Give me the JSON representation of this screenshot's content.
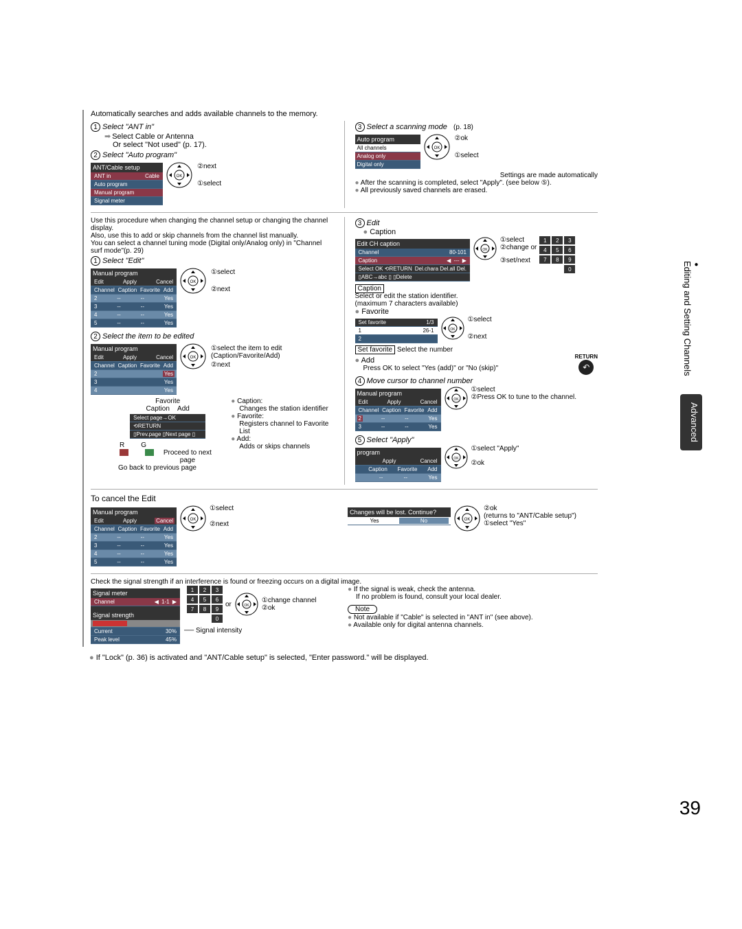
{
  "intro": "Automatically searches and adds available channels to the memory.",
  "sec1": {
    "step1": "Select \"ANT in\"",
    "sub1a": "Select Cable or Antenna",
    "sub1b": "Or select \"Not used\" (p. 17).",
    "step2": "Select \"Auto program\"",
    "menu1_title": "ANT/Cable setup",
    "menu1": {
      "r1a": "ANT in",
      "r1b": "Cable",
      "r2": "Auto program",
      "r3": "Manual program",
      "r4": "Signal meter"
    },
    "lbl_next": "next",
    "lbl_select": "select",
    "step3": "Select a scanning mode",
    "step3p": "(p. 18)",
    "menu2_title": "Auto program",
    "menu2": {
      "r1": "All channels",
      "r2": "Analog only",
      "r3": "Digital only"
    },
    "lbl_ok": "ok",
    "after1": "Settings are made automatically",
    "after2": "After the scanning is completed, select \"Apply\". (see below ⑤).",
    "after3": "All previously saved channels are erased."
  },
  "sec2": {
    "intro1": "Use this procedure when changing the channel setup or changing the channel display.",
    "intro2": "Also, use this to add or skip channels from the channel list manually.",
    "intro3": "You can select a channel tuning mode (Digital only/Analog only) in \"Channel surf mode\"(p. 29)",
    "step1": "Select \"Edit\"",
    "menu_manual": "Manual program",
    "mt": {
      "edit": "Edit",
      "apply": "Apply",
      "cancel": "Cancel",
      "channel": "Channel",
      "caption": "Caption",
      "favorite": "Favorite",
      "add": "Add",
      "yes": "Yes"
    },
    "lbl_select": "select",
    "lbl_next": "next",
    "step2": "Select the item to be edited",
    "lbl_selectitem": "select the item to edit (Caption/Favorite/Add)",
    "col_fav": "Favorite",
    "col_cap": "Caption",
    "col_add": "Add",
    "b_cap": "Caption:",
    "b_cap_t": "Changes the station identifier",
    "b_fav": "Favorite:",
    "b_fav_t": "Registers channel to Favorite List",
    "b_add": "Add:",
    "b_add_t": "Adds or skips channels",
    "rg_r": "R",
    "rg_g": "G",
    "rg_proc": "Proceed to next page",
    "rg_back": "Go back to previous page",
    "step3": "Edit",
    "step3cap": "Caption",
    "editch": "Edit CH caption",
    "ch": "Channel",
    "ch_v": "80-101",
    "cap": "Caption",
    "cap_v": "---",
    "lbl_change": "change  or",
    "lbl_setnext": "set/next",
    "caption_h": "Caption",
    "caption_t1": "Select or edit the station identifier.",
    "caption_t2": "(maximum 7 characters available)",
    "fav_h": "Favorite",
    "setfav": "Set favorite",
    "setfav_n": "1/3",
    "sf1": "1",
    "sf1v": "26-1",
    "sf2": "2",
    "setfav_sel": "Select the number",
    "add_h": "Add",
    "add_t": "Press OK to select \"Yes (add)\" or \"No (skip)\"",
    "return": "RETURN",
    "step4": "Move cursor to channel number",
    "lbl_press": "Press OK to tune to the channel.",
    "step5": "Select \"Apply\"",
    "prog": "program",
    "lbl_selapply": "select \"Apply\"",
    "lbl_ok": "ok"
  },
  "sec3": {
    "title": "To cancel the Edit",
    "lbl_select": "select",
    "lbl_next": "next",
    "confirm": "Changes will be lost. Continue?",
    "yes": "Yes",
    "no": "No",
    "lbl_ok": "ok",
    "lbl_ret": "(returns to \"ANT/Cable setup\")",
    "lbl_selyes": "select \"Yes\""
  },
  "sec4": {
    "intro": "Check the signal strength if an interference is found or freezing occurs on a digital image.",
    "signal_meter": "Signal meter",
    "channel": "Channel",
    "ch_v": "1-1",
    "strength": "Signal strength",
    "current": "Current",
    "cur_v": "30%",
    "peak": "Peak level",
    "peak_v": "45%",
    "intensity": "Signal intensity",
    "or": "or",
    "lbl_change": "change channel",
    "lbl_ok": "ok",
    "b1": "If the signal is weak, check the antenna.",
    "b1b": "If no problem is found, consult your local dealer.",
    "note": "Note",
    "n1": "Not available if \"Cable\" is selected in \"ANT in\" (see above).",
    "n2": "Available only for digital antenna channels."
  },
  "footnote": "If \"Lock\" (p. 36) is activated and \"ANT/Cable setup\" is selected, \"Enter password.\" will be displayed.",
  "page": "39",
  "tabs": {
    "a": "Editing and Setting Channels",
    "b": "Advanced"
  }
}
